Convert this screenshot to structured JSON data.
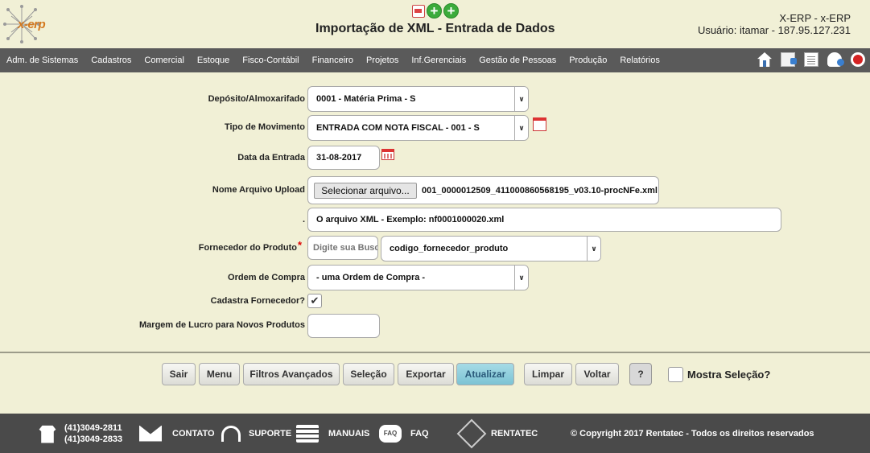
{
  "header": {
    "logo_text": "x-erp",
    "page_title": "Importação de XML - Entrada de Dados",
    "company": "X-ERP - x-ERP",
    "user_info": "Usuário: itamar - 187.95.127.231"
  },
  "nav": {
    "items": [
      "Adm. de Sistemas",
      "Cadastros",
      "Comercial",
      "Estoque",
      "Fisco-Contábil",
      "Financeiro",
      "Projetos",
      "Inf.Gerenciais",
      "Gestão de Pessoas",
      "Produção",
      "Relatórios"
    ]
  },
  "form": {
    "deposito": {
      "label": "Depósito/Almoxarifado",
      "value": "0001 - Matéria Prima - S"
    },
    "tipo_movimento": {
      "label": "Tipo de Movimento",
      "value": "ENTRADA COM NOTA FISCAL - 001 - S"
    },
    "data_entrada": {
      "label": "Data da Entrada",
      "value": "31-08-2017"
    },
    "arquivo": {
      "label": "Nome Arquivo Upload",
      "button": "Selecionar arquivo...",
      "filename": "001_0000012509_411000860568195_v03.10-procNFe.xml"
    },
    "exemplo": {
      "label": ".",
      "value": "O arquivo XML - Exemplo: nf0001000020.xml"
    },
    "fornecedor": {
      "label": "Fornecedor do Produto",
      "required_mark": "*",
      "search_placeholder": "Digite sua Busca",
      "value": "codigo_fornecedor_produto"
    },
    "ordem_compra": {
      "label": "Ordem de Compra",
      "value": "- uma Ordem de Compra -"
    },
    "cadastra_fornecedor": {
      "label": "Cadastra Fornecedor?",
      "checked": true,
      "check_glyph": "✔"
    },
    "margem_lucro": {
      "label": "Margem de Lucro para Novos Produtos",
      "value": ""
    }
  },
  "buttons": {
    "sair": "Sair",
    "menu": "Menu",
    "filtros": "Filtros Avançados",
    "selecao": "Seleção",
    "exportar": "Exportar",
    "atualizar": "Atualizar",
    "limpar": "Limpar",
    "voltar": "Voltar",
    "help": "?",
    "mostra_selecao": "Mostra Seleção?"
  },
  "footer": {
    "phone1": "(41)3049-2811",
    "phone2": "(41)3049-2833",
    "contato": "CONTATO",
    "suporte": "SUPORTE",
    "manuais": "MANUAIS",
    "faq_icon": "FAQ",
    "faq": "FAQ",
    "rentatec": "RENTATEC",
    "copyright": "© Copyright 2017 Rentatec - Todos os direitos reservados"
  },
  "colors": {
    "background": "#f1f0d6",
    "nav": "#5a5a5a",
    "footer": "#4a4a4a",
    "active_button": "#8ccddc",
    "accent": "#3bab3b"
  }
}
